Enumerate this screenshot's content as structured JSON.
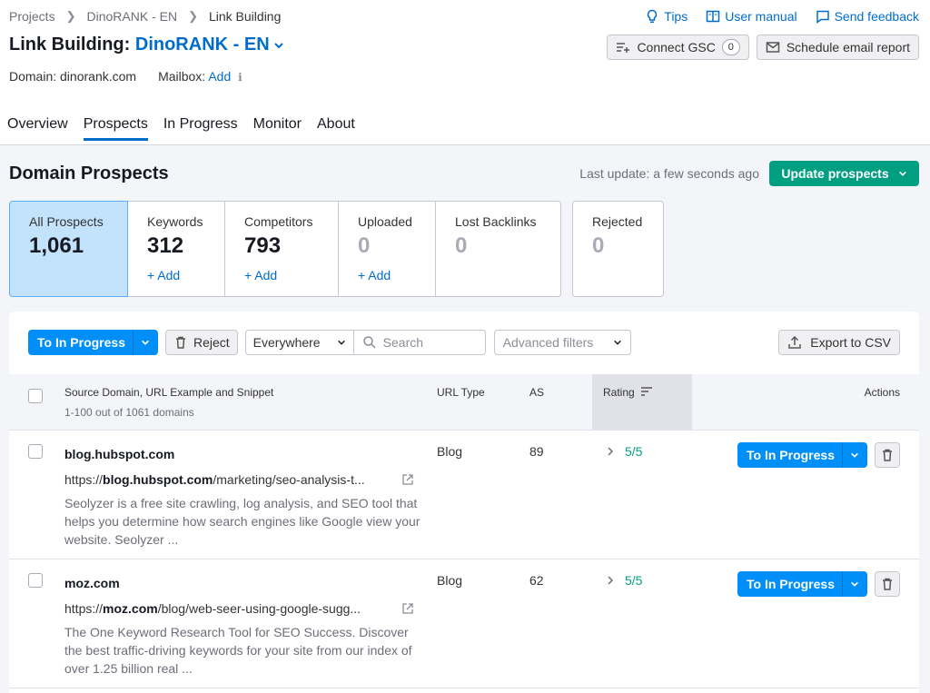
{
  "breadcrumb": [
    "Projects",
    "DinoRANK - EN",
    "Link Building"
  ],
  "top_links": {
    "tips": "Tips",
    "manual": "User manual",
    "feedback": "Send feedback"
  },
  "header": {
    "title_prefix": "Link Building: ",
    "project": "DinoRANK - EN"
  },
  "buttons": {
    "connect_gsc": "Connect GSC",
    "gsc_count": "0",
    "schedule": "Schedule email report"
  },
  "domain_line": {
    "domain": "Domain: dinorank.com",
    "mailbox_label": "Mailbox:",
    "mailbox_add": "Add"
  },
  "tabs": [
    "Overview",
    "Prospects",
    "In Progress",
    "Monitor",
    "About"
  ],
  "active_tab": "Prospects",
  "section": {
    "title": "Domain Prospects",
    "last_update": "Last update: a few seconds ago",
    "update_btn": "Update prospects"
  },
  "cards": [
    {
      "label": "All Prospects",
      "value": "1,061",
      "add": ""
    },
    {
      "label": "Keywords",
      "value": "312",
      "add": "+ Add"
    },
    {
      "label": "Competitors",
      "value": "793",
      "add": "+ Add"
    },
    {
      "label": "Uploaded",
      "value": "0",
      "add": "+ Add"
    },
    {
      "label": "Lost Backlinks",
      "value": "0",
      "add": ""
    },
    {
      "label": "Rejected",
      "value": "0",
      "add": ""
    }
  ],
  "toolbar": {
    "to_in_progress": "To In Progress",
    "reject": "Reject",
    "scope": "Everywhere",
    "search_placeholder": "Search",
    "advanced": "Advanced filters",
    "export": "Export to CSV"
  },
  "table": {
    "col_source": "Source Domain, URL Example and Snippet",
    "col_source_sub": "1-100 out of 1061 domains",
    "col_type": "URL Type",
    "col_as": "AS",
    "col_rating": "Rating",
    "col_actions": "Actions",
    "rows": [
      {
        "domain": "blog.hubspot.com",
        "url_pre": "https://",
        "url_bold": "blog.hubspot.com",
        "url_post": "/marketing/seo-analysis-t...",
        "snippet": "Seolyzer is a free site crawling, log analysis, and SEO tool that helps you determine how search engines like Google view your website. Seolyzer ...",
        "type": "Blog",
        "as": "89",
        "rating": "5/5",
        "action": "To In Progress"
      },
      {
        "domain": "moz.com",
        "url_pre": "https://",
        "url_bold": "moz.com",
        "url_post": "/blog/web-seer-using-google-sugg...",
        "snippet": "The One Keyword Research Tool for SEO Success. Discover the best traffic-driving keywords for your site from our index of over 1.25 billion real ...",
        "type": "Blog",
        "as": "62",
        "rating": "5/5",
        "action": "To In Progress"
      }
    ]
  },
  "colors": {
    "accent": "#006dca",
    "primary_btn": "#008ff8",
    "green": "#009f81",
    "active_card": "#c3e2fc"
  }
}
